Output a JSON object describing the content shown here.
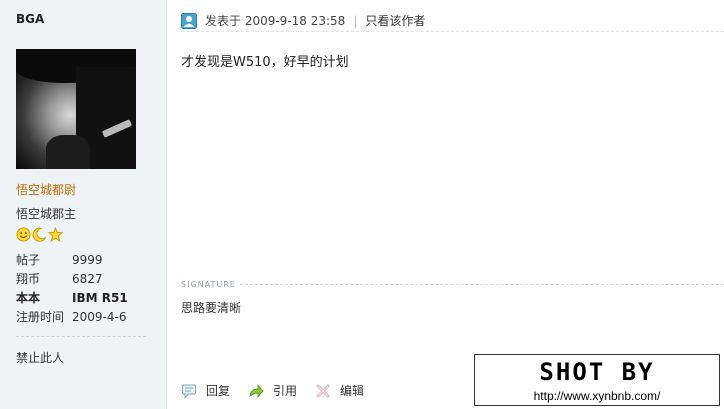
{
  "author": {
    "name": "BGA",
    "rank_title": "悟空城都尉",
    "group_title": "悟空城郡主",
    "badges": [
      "smiley-icon",
      "moon-icon",
      "star-icon"
    ],
    "stats": [
      {
        "label": "帖子",
        "value": "9999",
        "bold": false
      },
      {
        "label": "翔币",
        "value": "6827",
        "bold": false
      },
      {
        "label": "本本",
        "value": "IBM R51",
        "bold": true
      },
      {
        "label": "注册时间",
        "value": "2009-4-6",
        "bold": false
      }
    ],
    "ban_link": "禁止此人"
  },
  "post": {
    "posted_at": "发表于 2009-9-18 23:58",
    "only_author": "只看该作者",
    "content": "才发现是W510，好早的计划",
    "signature_label": "SIGNATURE",
    "signature": "思路要清晰",
    "actions": {
      "reply": "回复",
      "quote": "引用",
      "edit": "编辑"
    }
  },
  "watermark": {
    "title": "SHOT BY",
    "url": "http://www.xynbnb.com/"
  }
}
